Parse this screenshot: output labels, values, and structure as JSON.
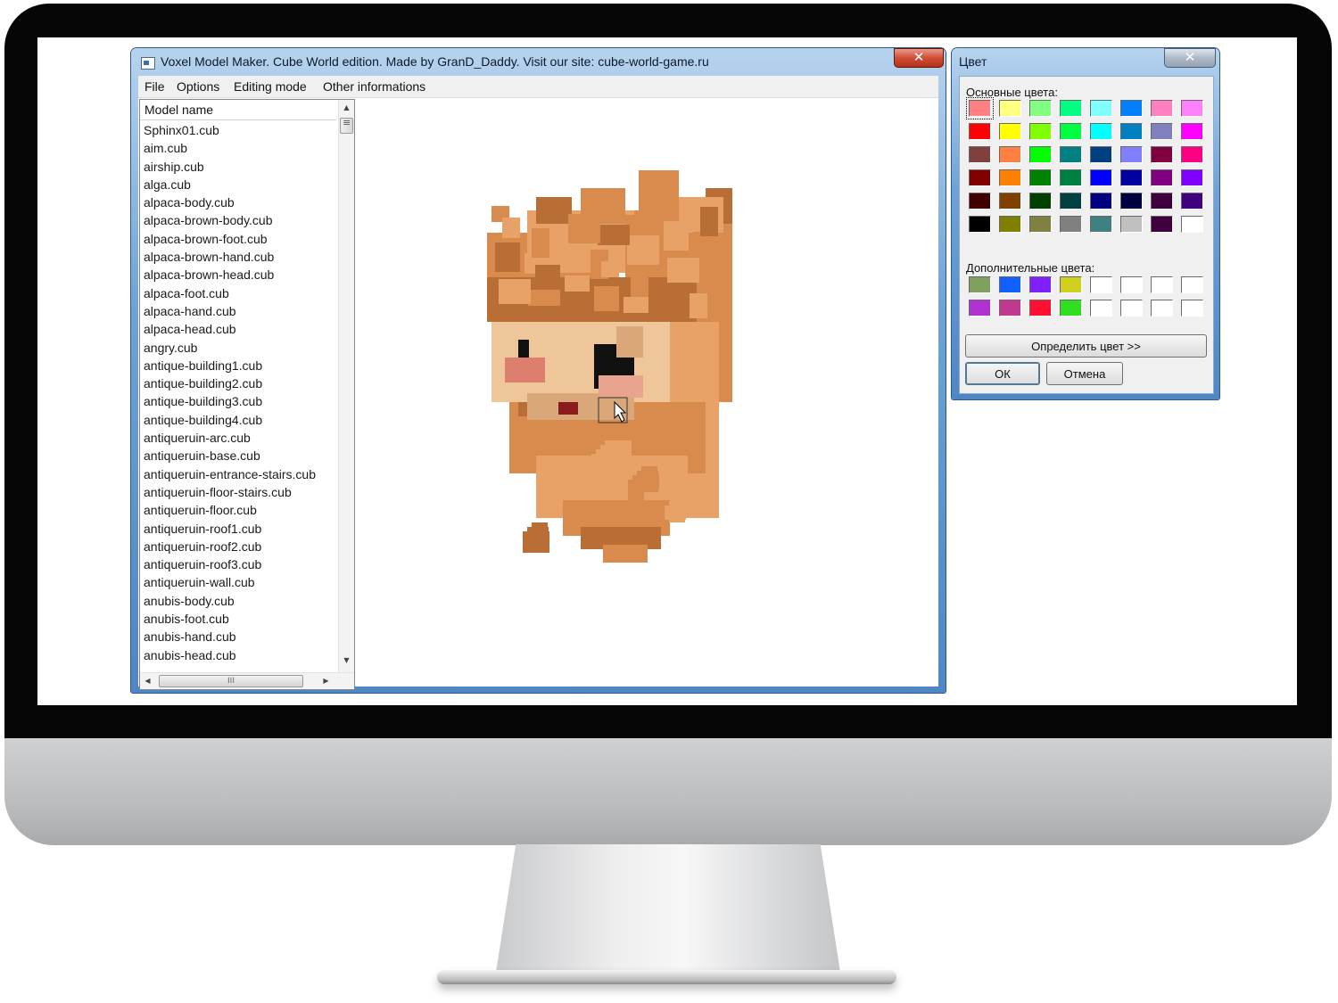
{
  "main_window": {
    "title": "Voxel Model Maker. Cube World edition. Made by GranD_Daddy. Visit our site: cube-world-game.ru",
    "close_glyph": "✕",
    "menu": [
      "File",
      "Options",
      "Editing mode",
      "Other informations"
    ]
  },
  "model_list": {
    "header": "Model name",
    "items": [
      "Sphinx01.cub",
      "aim.cub",
      "airship.cub",
      "alga.cub",
      "alpaca-body.cub",
      "alpaca-brown-body.cub",
      "alpaca-brown-foot.cub",
      "alpaca-brown-hand.cub",
      "alpaca-brown-head.cub",
      "alpaca-foot.cub",
      "alpaca-hand.cub",
      "alpaca-head.cub",
      "angry.cub",
      "antique-building1.cub",
      "antique-building2.cub",
      "antique-building3.cub",
      "antique-building4.cub",
      "antiqueruin-arc.cub",
      "antiqueruin-base.cub",
      "antiqueruin-entrance-stairs.cub",
      "antiqueruin-floor-stairs.cub",
      "antiqueruin-floor.cub",
      "antiqueruin-roof1.cub",
      "antiqueruin-roof2.cub",
      "antiqueruin-roof3.cub",
      "antiqueruin-wall.cub",
      "anubis-body.cub",
      "anubis-foot.cub",
      "anubis-hand.cub",
      "anubis-head.cub"
    ],
    "scroll_up": "▲",
    "scroll_down": "▼",
    "scroll_left": "◀",
    "scroll_right": "▶",
    "hthumb_grip": "III"
  },
  "viewport": {
    "icon": "voxel-head-3d-model",
    "palette": {
      "hair_base": "#d98b4e",
      "hair_light": "#e8a267",
      "hair_dark": "#b86e34",
      "skin": "#efc59a",
      "skin_shade": "#d9a77a",
      "cheek": "#dd7f6e",
      "eye": "#111111",
      "mouth": "#8b1a1a"
    }
  },
  "color_dialog": {
    "title": "Цвет",
    "close_glyph": "✕",
    "basic_label": "Основные цвета:",
    "basic_colors": [
      [
        "#ff8080",
        "#ffff80",
        "#80ff80",
        "#00ff80",
        "#80ffff",
        "#0080ff",
        "#ff80c0",
        "#ff80ff"
      ],
      [
        "#ff0000",
        "#ffff00",
        "#80ff00",
        "#00ff40",
        "#00ffff",
        "#0080c0",
        "#8080c0",
        "#ff00ff"
      ],
      [
        "#804040",
        "#ff8040",
        "#00ff00",
        "#008080",
        "#004080",
        "#8080ff",
        "#800040",
        "#ff0080"
      ],
      [
        "#800000",
        "#ff8000",
        "#008000",
        "#008040",
        "#0000ff",
        "#0000a0",
        "#800080",
        "#8000ff"
      ],
      [
        "#400000",
        "#804000",
        "#004000",
        "#004040",
        "#000080",
        "#000040",
        "#400040",
        "#400080"
      ],
      [
        "#000000",
        "#808000",
        "#808040",
        "#808080",
        "#408080",
        "#c0c0c0",
        "#400040",
        "#ffffff"
      ]
    ],
    "selected_color": "#ff8080",
    "custom_label": "Дополнительные цвета:",
    "custom_colors": [
      [
        "#80a060",
        "#1060ff",
        "#8020ff",
        "#d0d020",
        "#ffffff",
        "#ffffff",
        "#ffffff",
        "#ffffff"
      ],
      [
        "#b030d0",
        "#c03890",
        "#ff1030",
        "#30e020",
        "#ffffff",
        "#ffffff",
        "#ffffff",
        "#ffffff"
      ]
    ],
    "define_button": "Определить цвет >>",
    "ok_button": "ОК",
    "cancel_button": "Отмена"
  }
}
